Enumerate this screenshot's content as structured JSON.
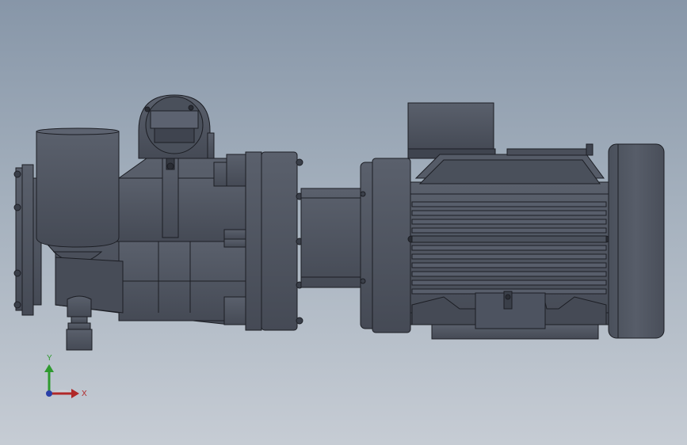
{
  "viewport": {
    "background_top": "#8796a8",
    "background_bottom": "#c6ccd4"
  },
  "model": {
    "body_color": "#4f5561",
    "dark_color": "#3f444f",
    "edge_color": "#1c1e24",
    "highlight_color": "#6a7080"
  },
  "triad": {
    "x_label": "X",
    "y_label": "Y",
    "x_color": "#b02828",
    "y_color": "#2f9a2f",
    "z_color": "#2a3fa8"
  }
}
